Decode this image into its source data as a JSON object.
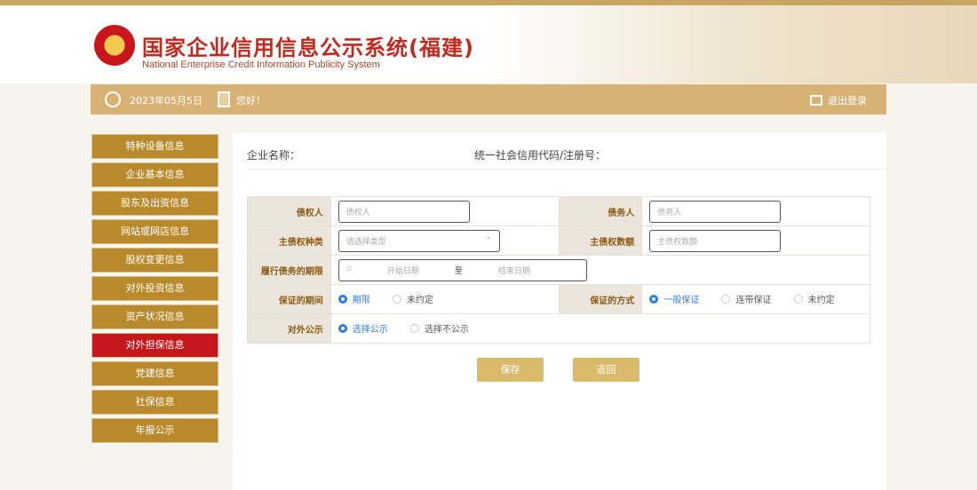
{
  "header": {
    "title": "国家企业信用信息公示系统(福建)",
    "subtitle": "National Enterprise Credit Information Publicity System"
  },
  "topbar": {
    "date": "2023年05月5日",
    "greeting": "您好！",
    "logout": "退出登录"
  },
  "sidebar": {
    "items": [
      {
        "label": "特种设备信息"
      },
      {
        "label": "企业基本信息"
      },
      {
        "label": "股东及出资信息"
      },
      {
        "label": "网站或网店信息"
      },
      {
        "label": "股权变更信息"
      },
      {
        "label": "对外投资信息"
      },
      {
        "label": "资产状况信息"
      },
      {
        "label": "对外担保信息",
        "active": true
      },
      {
        "label": "党建信息"
      },
      {
        "label": "社保信息"
      },
      {
        "label": "年报公示"
      }
    ]
  },
  "company": {
    "name_label": "企业名称：",
    "code_label": "统一社会信用代码/注册号："
  },
  "form": {
    "creditor_label": "债权人",
    "creditor_placeholder": "债权人",
    "debtor_label": "债务人",
    "debtor_placeholder": "债务人",
    "type_label": "主债权种类",
    "type_placeholder": "请选择类型",
    "amount_label": "主债权数额",
    "amount_placeholder": "主债权数额",
    "term_label": "履行债务的期限",
    "start_placeholder": "开始日期",
    "to": "至",
    "end_placeholder": "结束日期",
    "period_label": "保证的期间",
    "period_options": [
      "期限",
      "未约定"
    ],
    "method_label": "保证的方式",
    "method_options": [
      "一般保证",
      "连带保证",
      "未约定"
    ],
    "publicity_label": "对外公示",
    "publicity_options": [
      "选择公示",
      "选择不公示"
    ]
  },
  "buttons": {
    "save": "保存",
    "back": "返回"
  }
}
